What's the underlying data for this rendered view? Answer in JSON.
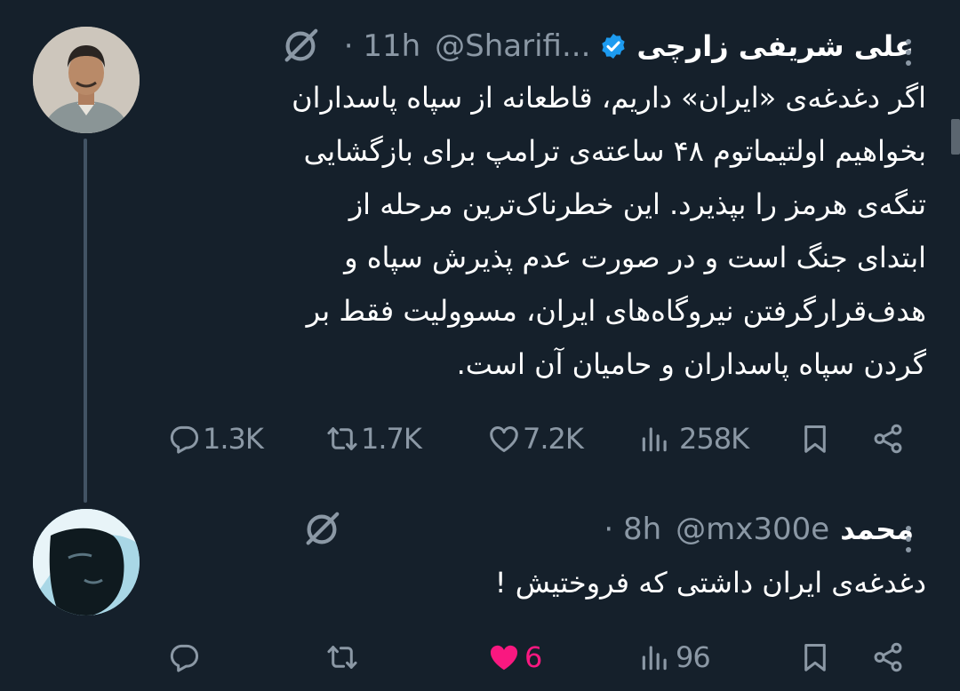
{
  "tweet": {
    "author_name": "علی شریفی زارچی",
    "handle": "@Sharifi...",
    "time": "· 11h",
    "text_lines": [
      "اگر دغدغه‌ی «ایران» داریم، قاطعانه از سپاه پاسداران",
      "بخواهیم اولتیماتوم ۴۸ ساعته‌ی ترامپ برای بازگشایی",
      "تنگه‌ی هرمز را بپذیرد. این خطرناک‌ترین مرحله از",
      "ابتدای جنگ است و در صورت عدم پذیرش سپاه و",
      "هدف‌قرارگرفتن نیروگاه‌های ایران، مسوولیت فقط بر",
      "گردن سپاه پاسداران و حامیان آن است."
    ],
    "replies": "1.3K",
    "reposts": "1.7K",
    "likes": "7.2K",
    "views": "258K"
  },
  "reply": {
    "author_name": "محمد",
    "handle": "@mx300e",
    "time": "· 8h",
    "text": "دغدغه‌ی ایران داشتی که فروختیش !",
    "replies": "",
    "reposts": "",
    "likes": "6",
    "views": "96",
    "liked": true
  },
  "icons": {
    "verified": "verified-badge-icon",
    "grok": "grok-icon",
    "more": "more-icon",
    "reply": "reply-icon",
    "repost": "repost-icon",
    "like": "heart-icon",
    "views": "views-icon",
    "bookmark": "bookmark-icon",
    "share": "share-icon"
  },
  "colors": {
    "background": "#15202b",
    "verified": "#1d9bf0",
    "like_active": "#f91880",
    "muted": "#8b98a5"
  }
}
